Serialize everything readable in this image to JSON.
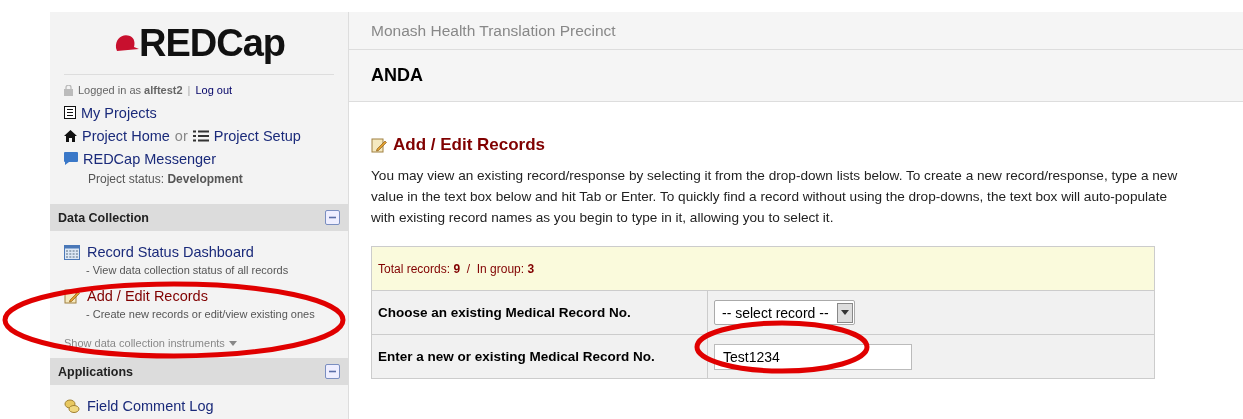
{
  "sidebar": {
    "logo": "REDCap",
    "login": {
      "prefix": "Logged in as",
      "user": "alftest2",
      "sep": "|",
      "logout": "Log out"
    },
    "nav": {
      "my_projects": "My Projects",
      "project_home": "Project Home",
      "or": "or",
      "project_setup": "Project Setup",
      "messenger": "REDCap Messenger"
    },
    "status": {
      "label": "Project status:",
      "value": "Development"
    },
    "sections": [
      {
        "title": "Data Collection",
        "expanded": true,
        "items": [
          {
            "kind": "dashboard",
            "label": "Record Status Dashboard",
            "note": "- View data collection status of all records",
            "active": false
          },
          {
            "kind": "records",
            "label": "Add / Edit Records",
            "note": "- Create new records or edit/view existing ones",
            "active": true
          }
        ],
        "more": "Show data collection instruments"
      },
      {
        "title": "Applications",
        "expanded": true,
        "items": [
          {
            "kind": "comments",
            "label": "Field Comment Log",
            "active": false
          }
        ]
      }
    ]
  },
  "header": {
    "institution": "Monash Health Translation Precinct",
    "project": "ANDA"
  },
  "page": {
    "title": "Add / Edit Records",
    "intro": "You may view an existing record/response by selecting it from the drop-down lists below. To create a new record/response, type a new value in the text box below and hit Tab or Enter. To quickly find a record without using the drop-downs, the text box will auto-populate with existing record names as you begin to type in it, allowing you to select it.",
    "counts": {
      "total_label": "Total records:",
      "total": "9",
      "group_label": "In group:",
      "group": "3",
      "sep": "/"
    },
    "rows": [
      {
        "kind": "select",
        "label": "Choose an existing Medical Record No.",
        "value": "-- select record --"
      },
      {
        "kind": "text",
        "label": "Enter a new or existing Medical Record No.",
        "value": "Test1234"
      }
    ]
  }
}
